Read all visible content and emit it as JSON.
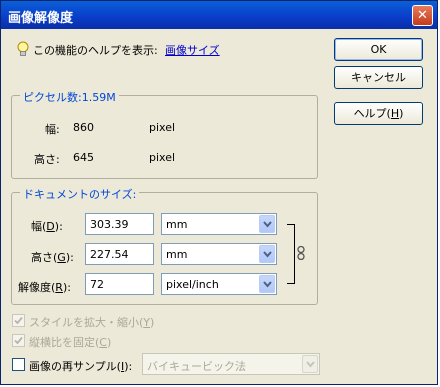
{
  "window": {
    "title": "画像解像度",
    "close_glyph": "✕"
  },
  "help": {
    "text": "この機能のヘルプを表示:",
    "link": "画像サイズ"
  },
  "buttons": {
    "ok": "OK",
    "cancel": "キャンセル",
    "help_label": "ヘルプ(",
    "help_key": "H",
    "help_end": ")"
  },
  "pixel_group": {
    "legend": "ピクセル数:1.59M",
    "width_label": "幅:",
    "width_value": "860",
    "width_unit": "pixel",
    "height_label": "高さ:",
    "height_value": "645",
    "height_unit": "pixel"
  },
  "doc_group": {
    "legend": "ドキュメントのサイズ:",
    "width": {
      "label_pre": "幅(",
      "key": "D",
      "label_post": "):",
      "value": "303.39",
      "unit": "mm"
    },
    "height": {
      "label_pre": "高さ(",
      "key": "G",
      "label_post": "):",
      "value": "227.54",
      "unit": "mm"
    },
    "resolution": {
      "label_pre": "解像度(",
      "key": "R",
      "label_post": "):",
      "value": "72",
      "unit": "pixel/inch"
    }
  },
  "options": {
    "scale_styles": {
      "label_pre": "スタイルを拡大・縮小(",
      "key": "Y",
      "label_post": ")",
      "checked": true,
      "enabled": false
    },
    "constrain": {
      "label_pre": "縦横比を固定(",
      "key": "C",
      "label_post": ")",
      "checked": true,
      "enabled": false
    },
    "resample": {
      "label_pre": "画像の再サンプル(",
      "key": "I",
      "label_post": "):",
      "checked": false,
      "enabled": true
    },
    "resample_method": "バイキュービック法"
  }
}
